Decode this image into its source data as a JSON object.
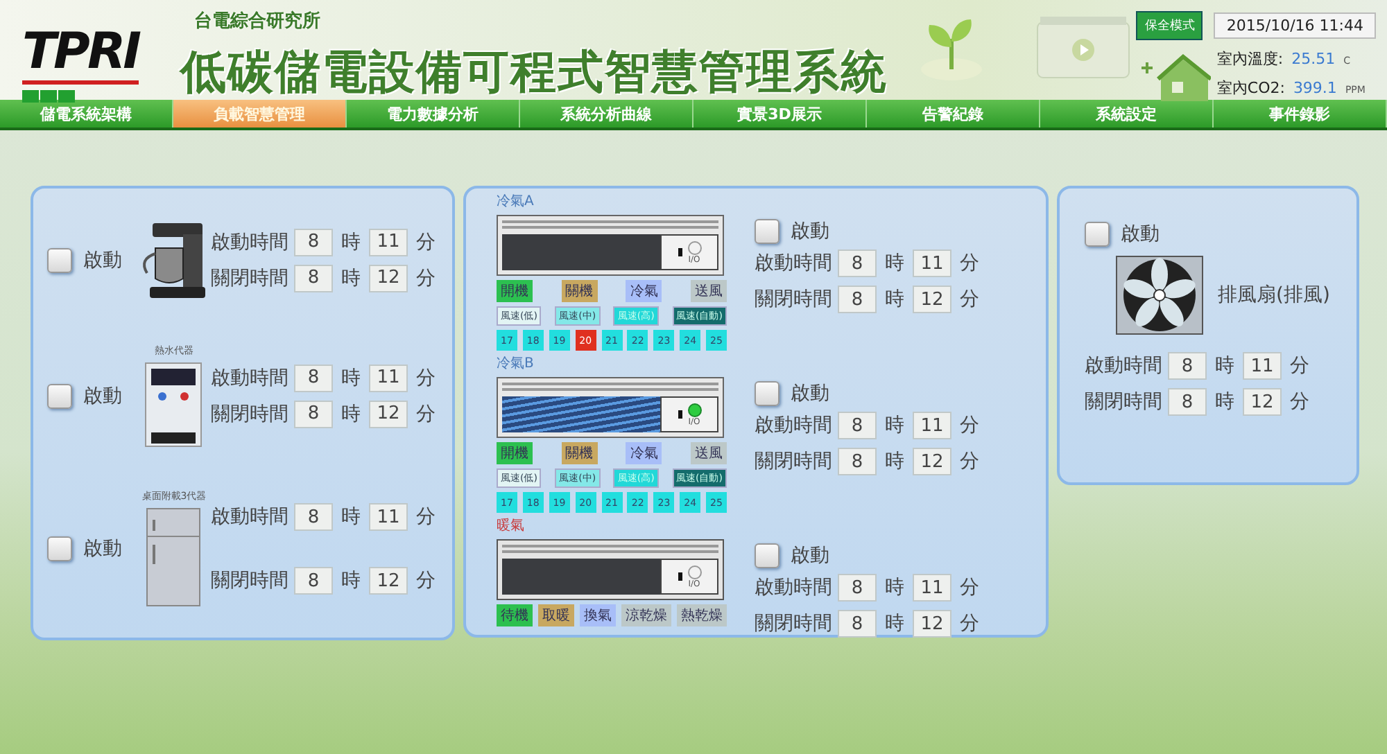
{
  "header": {
    "logo": "TPRI",
    "org": "台電綜合研究所",
    "title": "低碳儲電設備可程式智慧管理系統",
    "mode_button": "保全模式",
    "datetime": "2015/10/16 11:44",
    "readings": [
      {
        "label": "室內溫度:",
        "value": "25.51",
        "unit": "C"
      },
      {
        "label": "室內CO2:",
        "value": "399.1",
        "unit": "PPM"
      }
    ]
  },
  "nav": [
    {
      "label": "儲電系統架構",
      "selected": false
    },
    {
      "label": "負載智慧管理",
      "selected": true
    },
    {
      "label": "電力數據分析",
      "selected": false
    },
    {
      "label": "系統分析曲線",
      "selected": false
    },
    {
      "label": "實景3D展示",
      "selected": false
    },
    {
      "label": "告警紀錄",
      "selected": false
    },
    {
      "label": "系統設定",
      "selected": false
    },
    {
      "label": "事件錄影",
      "selected": false
    }
  ],
  "left_panel": {
    "devices": [
      {
        "kind": "coffee-maker",
        "start_label": "啟動",
        "checked": false,
        "times": [
          {
            "label": "啟動時間",
            "hour": "8",
            "hour_unit": "時",
            "minute": "11",
            "minute_unit": "分"
          },
          {
            "label": "關閉時間",
            "hour": "8",
            "hour_unit": "時",
            "minute": "12",
            "minute_unit": "分"
          }
        ]
      },
      {
        "kind": "water-dispenser",
        "caption": "熱水代器",
        "start_label": "啟動",
        "checked": false,
        "times": [
          {
            "label": "啟動時間",
            "hour": "8",
            "hour_unit": "時",
            "minute": "11",
            "minute_unit": "分"
          },
          {
            "label": "關閉時間",
            "hour": "8",
            "hour_unit": "時",
            "minute": "12",
            "minute_unit": "分"
          }
        ]
      },
      {
        "kind": "fridge",
        "caption": "桌面附載3代器",
        "start_label": "啟動",
        "checked": false,
        "times": [
          {
            "label": "啟動時間",
            "hour": "8",
            "hour_unit": "時",
            "minute": "11",
            "minute_unit": "分"
          },
          {
            "label": "關閉時間",
            "hour": "8",
            "hour_unit": "時",
            "minute": "12",
            "minute_unit": "分"
          }
        ]
      }
    ]
  },
  "middle_panel": {
    "units": [
      {
        "kind": "ac",
        "name": "冷氣A",
        "switch_label": "I/O",
        "power_on": false,
        "start_label": "啟動",
        "checked": false,
        "modes": [
          {
            "label": "開機",
            "color": "#2cc050"
          },
          {
            "label": "關機",
            "color": "#c8a860"
          },
          {
            "label": "冷氣",
            "color": "#a8bef8"
          },
          {
            "label": "送風",
            "color": "#bcc8c8"
          }
        ],
        "speeds": [
          {
            "label": "風速(低)",
            "color": "#e2f4f4"
          },
          {
            "label": "風速(中)",
            "color": "#84e8e8"
          },
          {
            "label": "風速(高)",
            "color": "#22d8d8"
          },
          {
            "label": "風速(自動)",
            "color": "#146c6c"
          }
        ],
        "temps": [
          {
            "label": "17",
            "selected": false
          },
          {
            "label": "18",
            "selected": false
          },
          {
            "label": "19",
            "selected": false
          },
          {
            "label": "20",
            "selected": true
          },
          {
            "label": "21",
            "selected": false
          },
          {
            "label": "22",
            "selected": false
          },
          {
            "label": "23",
            "selected": false
          },
          {
            "label": "24",
            "selected": false
          },
          {
            "label": "25",
            "selected": false
          }
        ],
        "times": [
          {
            "label": "啟動時間",
            "hour": "8",
            "hour_unit": "時",
            "minute": "11",
            "minute_unit": "分"
          },
          {
            "label": "關閉時間",
            "hour": "8",
            "hour_unit": "時",
            "minute": "12",
            "minute_unit": "分"
          }
        ]
      },
      {
        "kind": "ac",
        "name": "冷氣B",
        "switch_label": "I/O",
        "power_on": true,
        "start_label": "啟動",
        "checked": false,
        "modes": [
          {
            "label": "開機",
            "color": "#2cc050"
          },
          {
            "label": "關機",
            "color": "#c8a860"
          },
          {
            "label": "冷氣",
            "color": "#a8bef8"
          },
          {
            "label": "送風",
            "color": "#bcc8c8"
          }
        ],
        "speeds": [
          {
            "label": "風速(低)",
            "color": "#e2f4f4"
          },
          {
            "label": "風速(中)",
            "color": "#84e8e8"
          },
          {
            "label": "風速(高)",
            "color": "#22d8d8"
          },
          {
            "label": "風速(自動)",
            "color": "#146c6c"
          }
        ],
        "temps": [
          {
            "label": "17",
            "selected": false
          },
          {
            "label": "18",
            "selected": false
          },
          {
            "label": "19",
            "selected": false
          },
          {
            "label": "20",
            "selected": false
          },
          {
            "label": "21",
            "selected": false
          },
          {
            "label": "22",
            "selected": false
          },
          {
            "label": "23",
            "selected": false
          },
          {
            "label": "24",
            "selected": false
          },
          {
            "label": "25",
            "selected": false
          }
        ],
        "times": [
          {
            "label": "啟動時間",
            "hour": "8",
            "hour_unit": "時",
            "minute": "11",
            "minute_unit": "分"
          },
          {
            "label": "關閉時間",
            "hour": "8",
            "hour_unit": "時",
            "minute": "12",
            "minute_unit": "分"
          }
        ]
      },
      {
        "kind": "heater",
        "name": "暖氣",
        "switch_label": "I/O",
        "power_on": false,
        "start_label": "啟動",
        "checked": false,
        "modes": [
          {
            "label": "待機",
            "color": "#2cc050"
          },
          {
            "label": "取暖",
            "color": "#c8a860"
          },
          {
            "label": "換氣",
            "color": "#a8bef8"
          },
          {
            "label": "涼乾燥",
            "color": "#bcc8c8"
          },
          {
            "label": "熱乾燥",
            "color": "#bcc8c8"
          }
        ],
        "times": [
          {
            "label": "啟動時間",
            "hour": "8",
            "hour_unit": "時",
            "minute": "11",
            "minute_unit": "分"
          },
          {
            "label": "關閉時間",
            "hour": "8",
            "hour_unit": "時",
            "minute": "12",
            "minute_unit": "分"
          }
        ]
      }
    ]
  },
  "right_panel": {
    "devices": [
      {
        "kind": "fan",
        "caption": "排風扇(排風)",
        "start_label": "啟動",
        "checked": false,
        "times": [
          {
            "label": "啟動時間",
            "hour": "8",
            "hour_unit": "時",
            "minute": "11",
            "minute_unit": "分"
          },
          {
            "label": "關閉時間",
            "hour": "8",
            "hour_unit": "時",
            "minute": "12",
            "minute_unit": "分"
          }
        ]
      }
    ]
  }
}
